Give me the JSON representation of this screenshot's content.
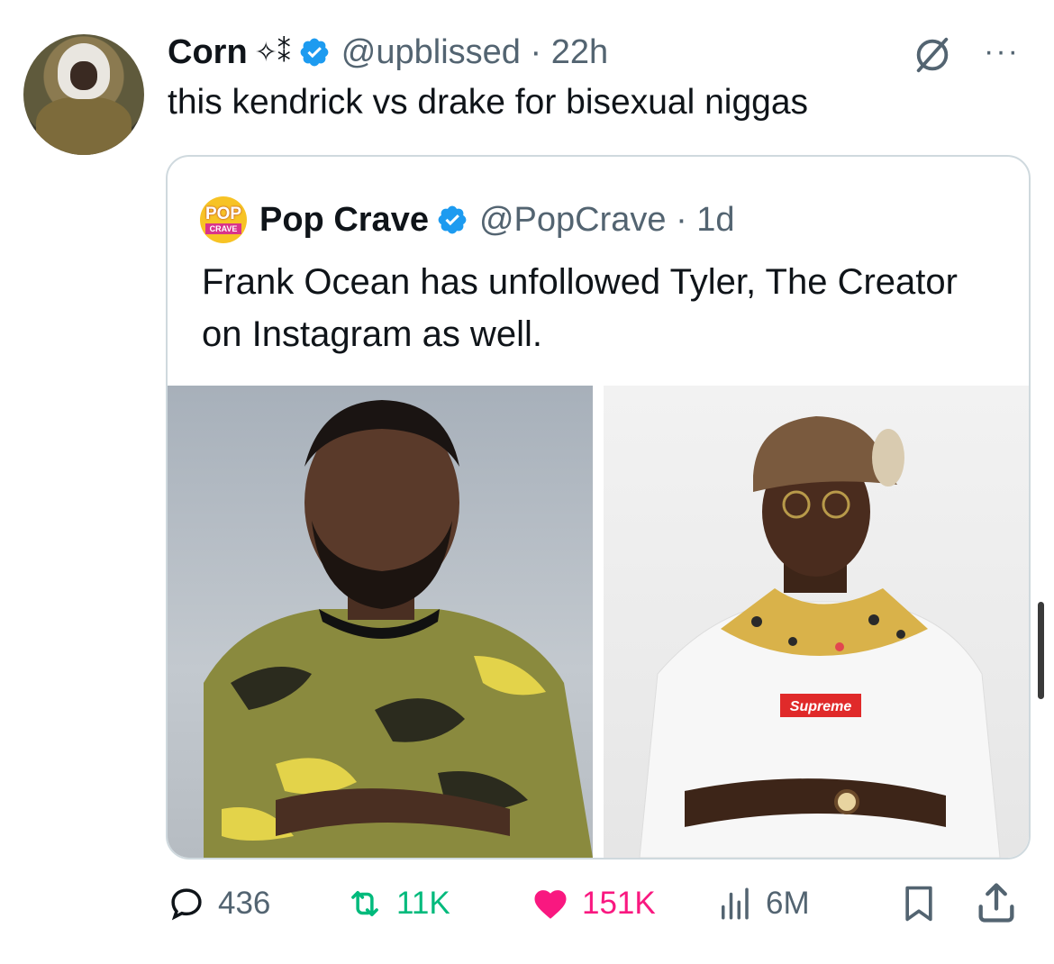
{
  "tweet": {
    "author_name": "Corn",
    "author_decoration": "✧⁑",
    "author_handle_time": "@upblissed · 22h",
    "text": "this kendrick vs drake for bisexual niggas"
  },
  "quoted": {
    "logo_text_top": "POP",
    "logo_text_bottom": "CRAVE",
    "author_name": "Pop Crave",
    "author_handle_time": "@PopCrave · 1d",
    "text": "Frank Ocean has unfollowed Tyler, The Creator on Instagram as well.",
    "photo_right_label": "Supreme"
  },
  "actions": {
    "replies": "436",
    "retweets": "11K",
    "likes": "151K",
    "views": "6M"
  },
  "colors": {
    "verified": "#1d9bf0",
    "retweet": "#00ba7c",
    "like": "#f91880",
    "secondary": "#536471"
  },
  "icons": [
    "verified-badge-icon",
    "grok-icon",
    "more-icon",
    "reply-icon",
    "retweet-icon",
    "like-icon",
    "views-icon",
    "bookmark-icon",
    "share-icon"
  ]
}
